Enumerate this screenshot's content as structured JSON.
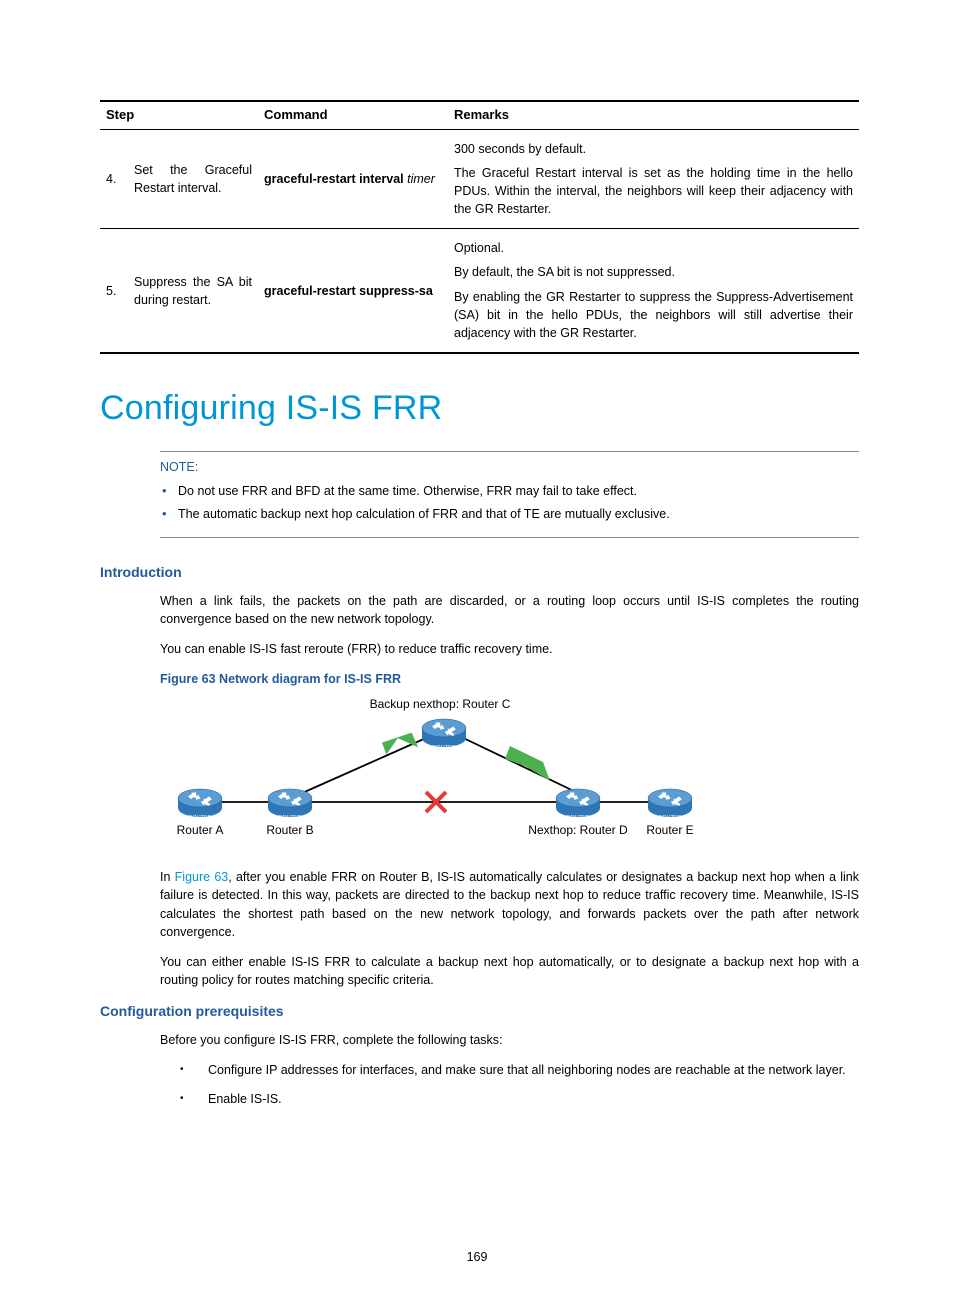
{
  "table": {
    "headers": {
      "step": "Step",
      "command": "Command",
      "remarks": "Remarks"
    },
    "rows": [
      {
        "num": "4.",
        "desc": "Set the Graceful Restart interval.",
        "cmd_bold": "graceful-restart interval",
        "cmd_ital": "timer",
        "remarks": [
          "300 seconds by default.",
          "The Graceful Restart interval is set as the holding time in the hello PDUs. Within the interval, the neighbors will keep their adjacency with the GR Restarter."
        ]
      },
      {
        "num": "5.",
        "desc": "Suppress the SA bit during restart.",
        "cmd_bold": "graceful-restart suppress-sa",
        "cmd_ital": "",
        "remarks": [
          "Optional.",
          "By default, the SA bit is not suppressed.",
          "By enabling the GR Restarter to suppress the Suppress-Advertisement (SA) bit in the hello PDUs, the neighbors will still advertise their adjacency with the GR Restarter."
        ]
      }
    ]
  },
  "main_heading": "Configuring IS-IS FRR",
  "note": {
    "label": "NOTE:",
    "items": [
      "Do not use FRR and BFD at the same time. Otherwise, FRR may fail to take effect.",
      "The automatic backup next hop calculation of FRR and that of TE are mutually exclusive."
    ]
  },
  "intro": {
    "heading": "Introduction",
    "p1": "When a link fails, the packets on the path are discarded, or a routing loop occurs until IS-IS completes the routing convergence based on the new network topology.",
    "p2": "You can enable IS-IS fast reroute (FRR) to reduce traffic recovery time.",
    "fig_label": "Figure 63 Network diagram for IS-IS FRR"
  },
  "diagram": {
    "backup_label": "Backup nexthop: Router C",
    "router_tag": "ROUTER",
    "labels": {
      "a": "Router A",
      "b": "Router B",
      "d": "Nexthop: Router D",
      "e": "Router E"
    }
  },
  "after_fig": {
    "prefix": "In ",
    "link": "Figure 63",
    "p1_rest": ", after you enable FRR on Router B, IS-IS automatically calculates or designates a backup next hop when a link failure is detected. In this way, packets are directed to the backup next hop to reduce traffic recovery time. Meanwhile, IS-IS calculates the shortest path based on the new network topology, and forwards packets over the path after network convergence.",
    "p2": "You can either enable IS-IS FRR to calculate a backup next hop automatically, or to designate a backup next hop with a routing policy for routes matching specific criteria."
  },
  "prereq": {
    "heading": "Configuration prerequisites",
    "intro": "Before you configure IS-IS FRR, complete the following tasks:",
    "items": [
      "Configure IP addresses for interfaces, and make sure that all neighboring nodes are reachable at the network layer.",
      "Enable IS-IS."
    ]
  },
  "page_number": "169"
}
